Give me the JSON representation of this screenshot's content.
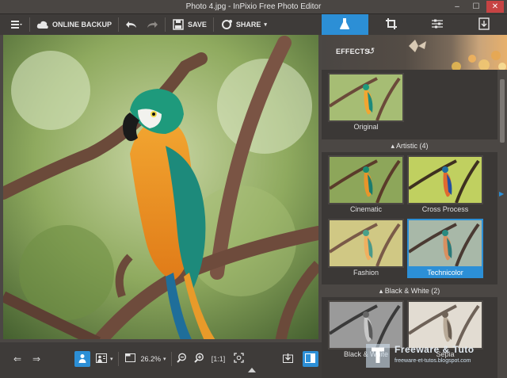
{
  "window": {
    "title": "Photo 4.jpg - InPixio Free Photo Editor",
    "controls": [
      "minimize",
      "maximize",
      "close"
    ]
  },
  "toolbar": {
    "menu_icon": "menu-icon",
    "online_backup_label": "ONLINE BACKUP",
    "undo_icon": "undo-icon",
    "redo_icon": "redo-icon",
    "save_label": "SAVE",
    "share_label": "SHARE"
  },
  "bottom": {
    "zoom_value": "26.2%"
  },
  "right_panel": {
    "tabs": [
      {
        "name": "effects-tab",
        "icon": "flask-icon",
        "active": true
      },
      {
        "name": "crop-tab",
        "icon": "crop-icon",
        "active": false
      },
      {
        "name": "adjust-tab",
        "icon": "sliders-icon",
        "active": false
      },
      {
        "name": "export-tab",
        "icon": "export-icon",
        "active": false
      }
    ],
    "effects_title": "EFFECTS",
    "original_label": "Original",
    "sections": [
      {
        "title": "Artistic (4)",
        "items": [
          "Cinematic",
          "Cross Process",
          "Fashion",
          "Technicolor"
        ],
        "selected": "Technicolor"
      },
      {
        "title": "Black & White (2)",
        "items": [
          "Black & White",
          "Sepia"
        ]
      }
    ]
  },
  "watermark": {
    "title": "Freeware & Tuto",
    "subtitle": "freeware-et-tutos.blogspot.com"
  },
  "colors": {
    "accent": "#2c8fd6",
    "panel": "#3b3836",
    "toolbar": "#3e3b39"
  }
}
